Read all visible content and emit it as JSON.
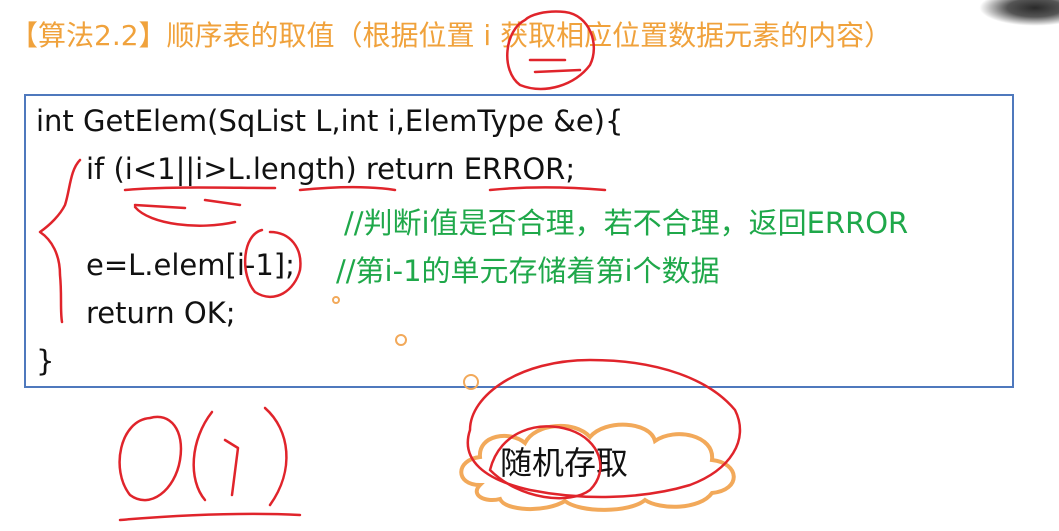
{
  "title": "【算法2.2】顺序表的取值（根据位置 i 获取相应位置数据元素的内容）",
  "code": {
    "line1": "int GetElem(SqList L,int i,ElemType &e){",
    "line2": "if (i<1||i>L.length) return ERROR;",
    "line3_comment": "//判断i值是否合理，若不合理，返回ERROR",
    "line4_code": "e=L.elem[i-1];",
    "line4_comment": "//第i-1的单元存储着第i个数据",
    "line5": "return OK;",
    "line6": "}"
  },
  "cloud_label": "随机存取",
  "colors": {
    "title": "#f0a23c",
    "box_border": "#4f79bd",
    "comment": "#1fa84a",
    "ink": "#e0242b",
    "cloud": "#f2a95a"
  }
}
